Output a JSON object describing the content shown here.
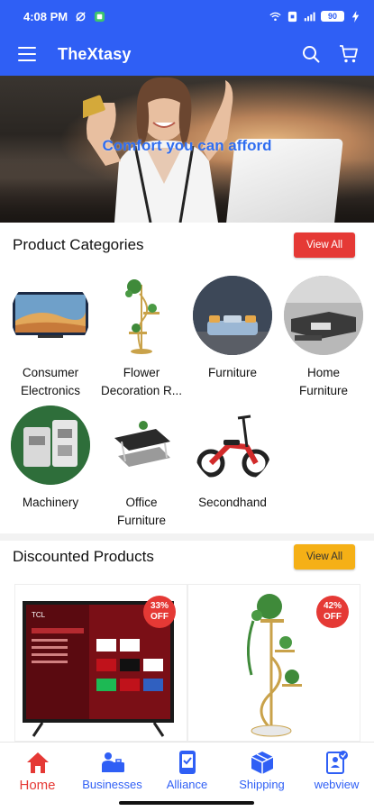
{
  "status_bar": {
    "time": "4:08 PM",
    "battery": "90"
  },
  "app_bar": {
    "title": "TheXtasy",
    "menu_icon": "hamburger-menu-icon",
    "search_icon": "search-icon",
    "cart_icon": "cart-icon"
  },
  "hero": {
    "text": "Comfort you can afford"
  },
  "categories_section": {
    "title": "Product Categories",
    "view_all": "View All",
    "items": [
      {
        "label1": "Consumer",
        "label2": "Electronics"
      },
      {
        "label1": "Flower",
        "label2": "Decoration R..."
      },
      {
        "label1": "Furniture",
        "label2": ""
      },
      {
        "label1": "Home",
        "label2": "Furniture"
      },
      {
        "label1": "Machinery",
        "label2": ""
      },
      {
        "label1": "Office",
        "label2": "Furniture"
      },
      {
        "label1": "Secondhand",
        "label2": ""
      }
    ]
  },
  "discounted_section": {
    "title": "Discounted Products",
    "view_all": "View All",
    "products": [
      {
        "discount": "33%",
        "off": "OFF"
      },
      {
        "discount": "42%",
        "off": "OFF"
      }
    ]
  },
  "bottom_nav": {
    "items": [
      {
        "label": "Home",
        "icon": "home-icon"
      },
      {
        "label": "Businesses",
        "icon": "businesses-icon"
      },
      {
        "label": "Alliance",
        "icon": "alliance-icon"
      },
      {
        "label": "Shipping",
        "icon": "shipping-icon"
      },
      {
        "label": "webview",
        "icon": "webview-icon"
      }
    ]
  },
  "colors": {
    "primary": "#2f5ff5",
    "accent_red": "#e53935",
    "accent_amber": "#f5b016"
  }
}
